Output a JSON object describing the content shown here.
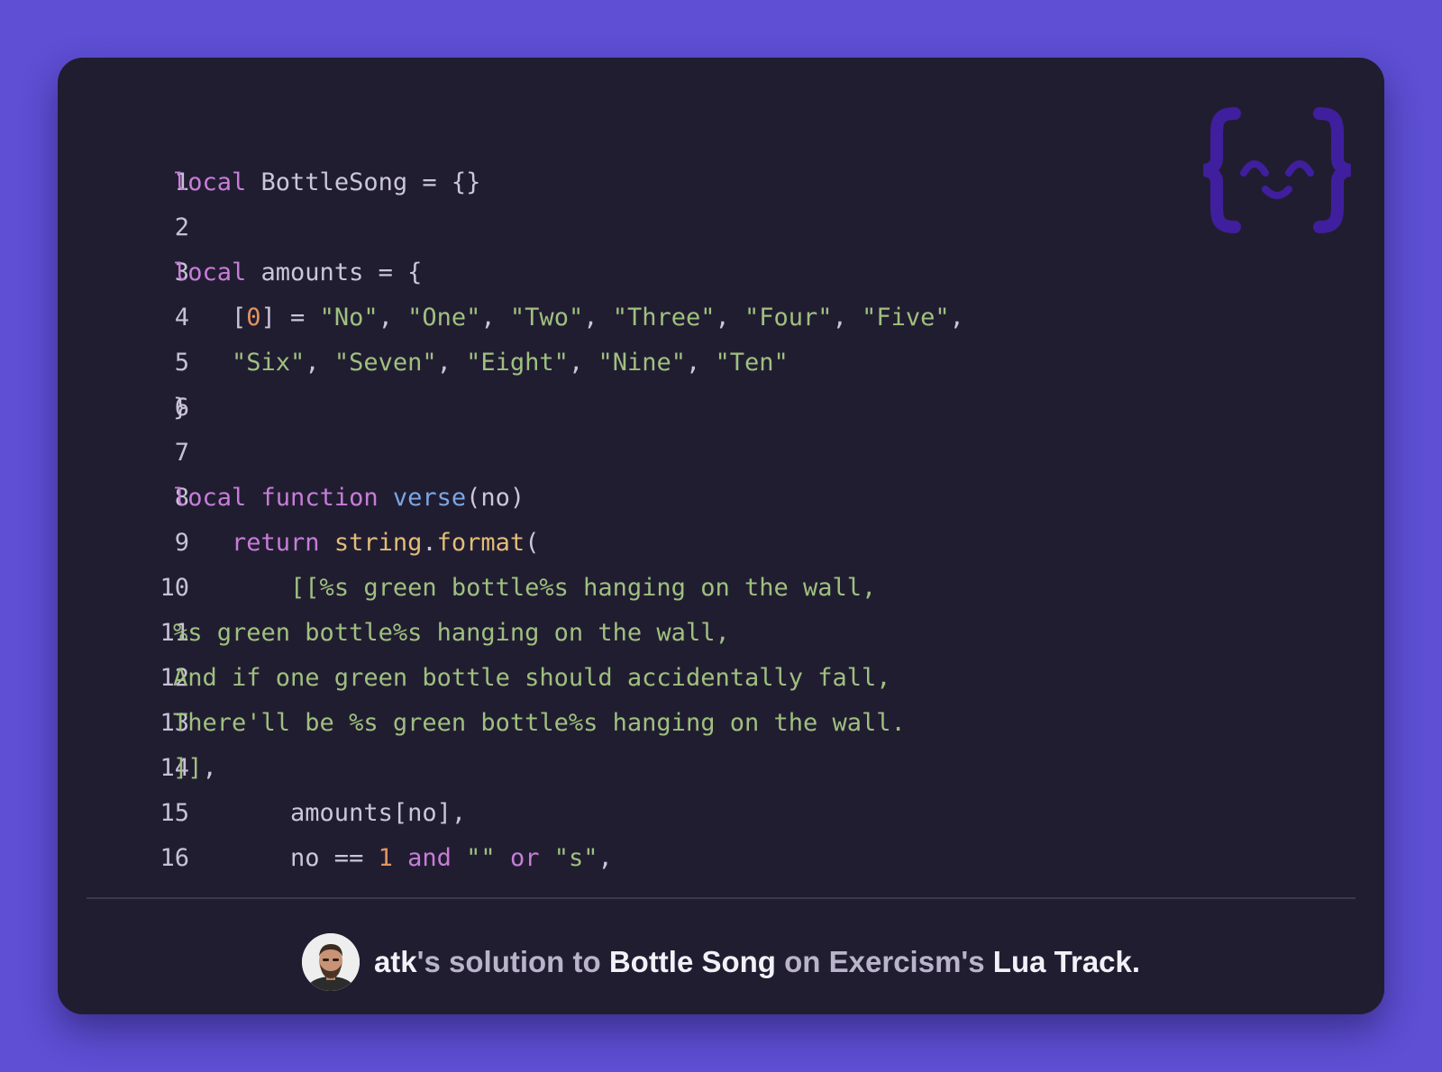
{
  "code": {
    "lines": [
      {
        "num": "1",
        "tokens": [
          {
            "t": "local",
            "c": "kw"
          },
          {
            "t": " BottleSong = {}",
            "c": "plain"
          }
        ]
      },
      {
        "num": "2",
        "tokens": []
      },
      {
        "num": "3",
        "tokens": [
          {
            "t": "local",
            "c": "kw"
          },
          {
            "t": " amounts = {",
            "c": "plain"
          }
        ]
      },
      {
        "num": "4",
        "tokens": [
          {
            "t": "    [",
            "c": "plain"
          },
          {
            "t": "0",
            "c": "num"
          },
          {
            "t": "] = ",
            "c": "plain"
          },
          {
            "t": "\"No\"",
            "c": "str"
          },
          {
            "t": ", ",
            "c": "plain"
          },
          {
            "t": "\"One\"",
            "c": "str"
          },
          {
            "t": ", ",
            "c": "plain"
          },
          {
            "t": "\"Two\"",
            "c": "str"
          },
          {
            "t": ", ",
            "c": "plain"
          },
          {
            "t": "\"Three\"",
            "c": "str"
          },
          {
            "t": ", ",
            "c": "plain"
          },
          {
            "t": "\"Four\"",
            "c": "str"
          },
          {
            "t": ", ",
            "c": "plain"
          },
          {
            "t": "\"Five\"",
            "c": "str"
          },
          {
            "t": ",",
            "c": "plain"
          }
        ]
      },
      {
        "num": "5",
        "tokens": [
          {
            "t": "    ",
            "c": "plain"
          },
          {
            "t": "\"Six\"",
            "c": "str"
          },
          {
            "t": ", ",
            "c": "plain"
          },
          {
            "t": "\"Seven\"",
            "c": "str"
          },
          {
            "t": ", ",
            "c": "plain"
          },
          {
            "t": "\"Eight\"",
            "c": "str"
          },
          {
            "t": ", ",
            "c": "plain"
          },
          {
            "t": "\"Nine\"",
            "c": "str"
          },
          {
            "t": ", ",
            "c": "plain"
          },
          {
            "t": "\"Ten\"",
            "c": "str"
          }
        ]
      },
      {
        "num": "6",
        "tokens": [
          {
            "t": "}",
            "c": "plain"
          }
        ]
      },
      {
        "num": "7",
        "tokens": []
      },
      {
        "num": "8",
        "tokens": [
          {
            "t": "local",
            "c": "kw"
          },
          {
            "t": " ",
            "c": "plain"
          },
          {
            "t": "function",
            "c": "kw"
          },
          {
            "t": " ",
            "c": "plain"
          },
          {
            "t": "verse",
            "c": "fn"
          },
          {
            "t": "(no)",
            "c": "plain"
          }
        ]
      },
      {
        "num": "9",
        "tokens": [
          {
            "t": "    ",
            "c": "plain"
          },
          {
            "t": "return",
            "c": "kw"
          },
          {
            "t": " ",
            "c": "plain"
          },
          {
            "t": "string",
            "c": "lib"
          },
          {
            "t": ".",
            "c": "plain"
          },
          {
            "t": "format",
            "c": "lib"
          },
          {
            "t": "(",
            "c": "plain"
          }
        ]
      },
      {
        "num": "10",
        "tokens": [
          {
            "t": "        ",
            "c": "plain"
          },
          {
            "t": "[[%s green bottle%s hanging on the wall,",
            "c": "str"
          }
        ]
      },
      {
        "num": "11",
        "tokens": [
          {
            "t": "%s green bottle%s hanging on the wall,",
            "c": "str"
          }
        ]
      },
      {
        "num": "12",
        "tokens": [
          {
            "t": "And if one green bottle should accidentally fall,",
            "c": "str"
          }
        ]
      },
      {
        "num": "13",
        "tokens": [
          {
            "t": "There'll be %s green bottle%s hanging on the wall.",
            "c": "str"
          }
        ]
      },
      {
        "num": "14",
        "tokens": [
          {
            "t": "]]",
            "c": "str"
          },
          {
            "t": ",",
            "c": "plain"
          }
        ]
      },
      {
        "num": "15",
        "tokens": [
          {
            "t": "        amounts[no],",
            "c": "plain"
          }
        ]
      },
      {
        "num": "16",
        "tokens": [
          {
            "t": "        no == ",
            "c": "plain"
          },
          {
            "t": "1",
            "c": "num"
          },
          {
            "t": " ",
            "c": "plain"
          },
          {
            "t": "and",
            "c": "kw"
          },
          {
            "t": " ",
            "c": "plain"
          },
          {
            "t": "\"\"",
            "c": "str"
          },
          {
            "t": " ",
            "c": "plain"
          },
          {
            "t": "or",
            "c": "kw"
          },
          {
            "t": " ",
            "c": "plain"
          },
          {
            "t": "\"s\"",
            "c": "str"
          },
          {
            "t": ",",
            "c": "plain"
          }
        ]
      }
    ]
  },
  "logo": {
    "icon": "exercism-logo-icon",
    "color": "#3f1f9e"
  },
  "footer": {
    "avatar_icon": "user-avatar",
    "author": "atk",
    "possessive": "'s",
    "solution_to": " solution to ",
    "exercise": "Bottle Song",
    "on": " on ",
    "platform": "Exercism",
    "platform_possessive": "'s",
    "track": "Lua Track."
  },
  "colors": {
    "background": "#5e4fd4",
    "card": "#211d31",
    "keyword": "#c77dd8",
    "function": "#7aa6e4",
    "string": "#9fc07f",
    "number": "#e2945f",
    "library": "#e2bd77"
  }
}
